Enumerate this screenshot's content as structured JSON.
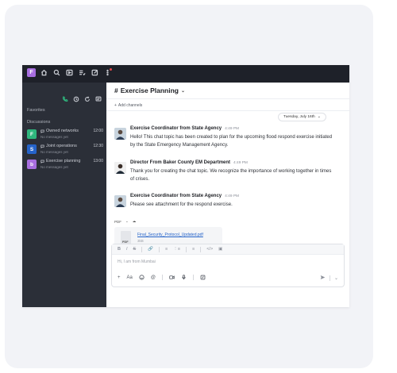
{
  "colors": {
    "sidebar_bg": "#2b2f38",
    "topbar_bg": "#1e2129",
    "link": "#2563c9",
    "green_call": "#2eb67d"
  },
  "workspace": {
    "badge": "F"
  },
  "topbar_icons": [
    "home-icon",
    "search-icon",
    "play-icon",
    "list-check-icon",
    "edit-icon",
    "more-icon"
  ],
  "sidebar": {
    "favorites_label": "Favorites",
    "discussions_label": "Discussions",
    "items": [
      {
        "avatar": "F",
        "avatar_color": "#2eb67d",
        "name": "Owned networks",
        "sub": "No messages yet",
        "time": "12:00"
      },
      {
        "avatar": "S",
        "avatar_color": "#2563c9",
        "name": "Joint operations",
        "sub": "No messages yet",
        "time": "12:30"
      },
      {
        "avatar": "b",
        "avatar_color": "#a86ee0",
        "name": "Exercise planning",
        "sub": "No messages yet",
        "time": "13:00"
      }
    ]
  },
  "channel": {
    "title": "Exercise Planning",
    "add_channels": "Add channels",
    "date": "Tuesday, July 16th"
  },
  "messages": [
    {
      "name": "Exercise Coordinator from State Agency",
      "time": "4:49 PM",
      "text": "Hello! This chat topic has been created to plan for the upcoming flood respond exercise initiated by the State Emergency Management Agency."
    },
    {
      "name": "Director From Baker County EM Department",
      "time": "4:49 PM",
      "text": "Thank you for creating the chat topic. We recognize the importance of working together in times of crises."
    },
    {
      "name": "Exercise Coordinator from State Agency",
      "time": "4:49 PM",
      "text": "Please see attachment for the respond exercise."
    }
  ],
  "attachment": {
    "type_label": "PDF",
    "file_name": "Final_Security_Protocol_Updated.pdf",
    "size": "3kB",
    "icon_label": "PDF"
  },
  "composer": {
    "placeholder": "Hi, I am from Mumbai"
  }
}
